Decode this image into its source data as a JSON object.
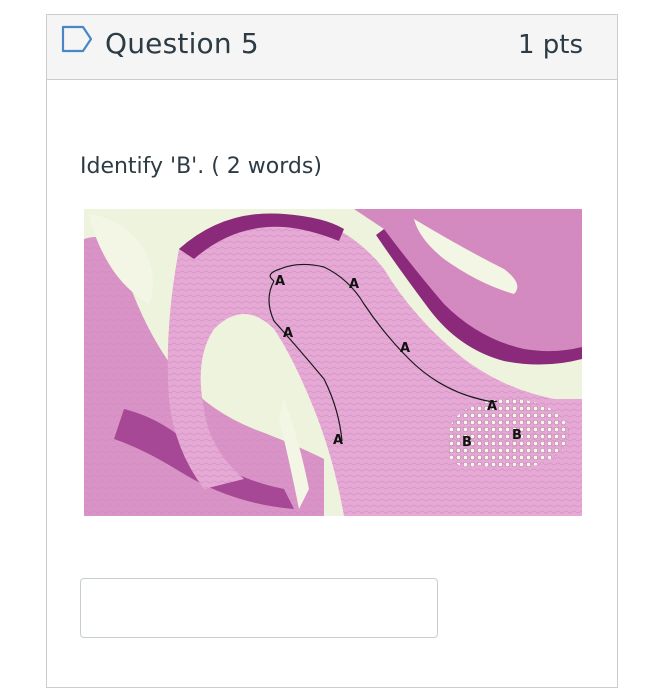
{
  "question": {
    "title": "Question 5",
    "points": "1 pts",
    "prompt": "Identify 'B'. ( 2 words)"
  },
  "figure": {
    "labels": [
      "A",
      "A",
      "A",
      "A",
      "A",
      "A",
      "B",
      "B"
    ]
  },
  "answer": {
    "value": "",
    "placeholder": ""
  },
  "colors": {
    "header_bg": "#f5f5f5",
    "border": "#c7cdd1",
    "text": "#2d3b45",
    "tissue_pink": "#d98fc6",
    "tissue_purple": "#8b2a7a",
    "lumen": "#f2f6e6"
  }
}
